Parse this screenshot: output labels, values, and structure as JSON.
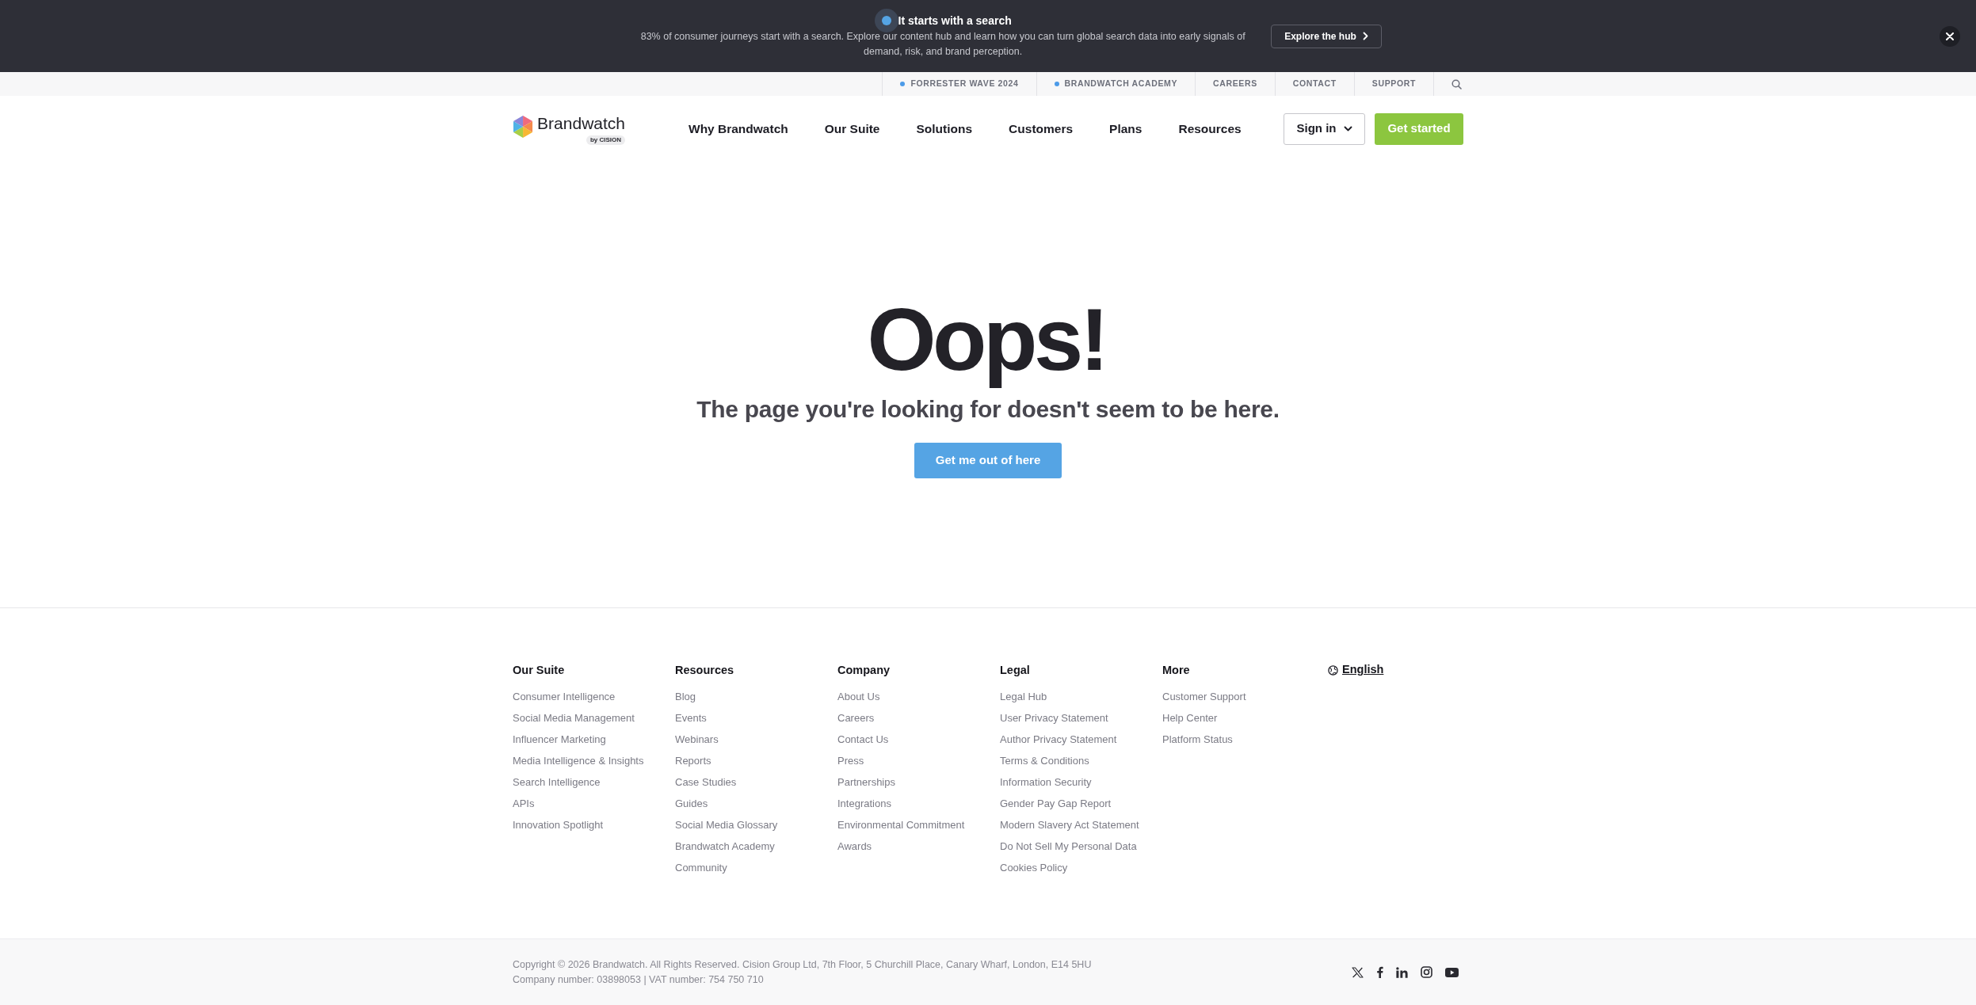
{
  "announcement": {
    "title": "It starts with a search",
    "text": "83% of consumer journeys start with a search. Explore our content hub and learn how you can turn global search data into early signals of demand, risk, and brand perception.",
    "button": "Explore the hub"
  },
  "utility_nav": {
    "links": [
      {
        "label": "FORRESTER WAVE 2024",
        "kind": "featured"
      },
      {
        "label": "BRANDWATCH ACADEMY",
        "kind": "featured"
      },
      {
        "label": "CAREERS",
        "kind": "plain"
      },
      {
        "label": "CONTACT",
        "kind": "plain"
      },
      {
        "label": "SUPPORT",
        "kind": "plain"
      }
    ]
  },
  "header": {
    "logo": {
      "name": "Brandwatch",
      "byline": "by CISION"
    },
    "nav": [
      "Why Brandwatch",
      "Our Suite",
      "Solutions",
      "Customers",
      "Plans",
      "Resources"
    ],
    "sign_in": "Sign in",
    "get_started": "Get started"
  },
  "error": {
    "heading": "Oops!",
    "message": "The page you're looking for doesn't seem to be here.",
    "button": "Get me out of here"
  },
  "footer": {
    "columns": [
      {
        "title": "Our Suite",
        "links": [
          "Consumer Intelligence",
          "Social Media Management",
          "Influencer Marketing",
          "Media Intelligence & Insights",
          "Search Intelligence",
          "APIs",
          "Innovation Spotlight"
        ]
      },
      {
        "title": "Resources",
        "links": [
          "Blog",
          "Events",
          "Webinars",
          "Reports",
          "Case Studies",
          "Guides",
          "Social Media Glossary",
          "Brandwatch Academy",
          "Community"
        ]
      },
      {
        "title": "Company",
        "links": [
          "About Us",
          "Careers",
          "Contact Us",
          "Press",
          "Partnerships",
          "Integrations",
          "Environmental Commitment",
          "Awards"
        ]
      },
      {
        "title": "Legal",
        "links": [
          "Legal Hub",
          "User Privacy Statement",
          "Author Privacy Statement",
          "Terms & Conditions",
          "Information Security",
          "Gender Pay Gap Report",
          "Modern Slavery Act Statement",
          "Do Not Sell My Personal Data",
          "Cookies Policy"
        ]
      },
      {
        "title": "More",
        "links": [
          "Customer Support",
          "Help Center",
          "Platform Status"
        ]
      }
    ],
    "language": "English"
  },
  "bottom_bar": {
    "lines": [
      "Copyright © 2026 Brandwatch. All Rights Reserved. Cision Group Ltd, 7th Floor, 5 Churchill Place, Canary Wharf, London, E14 5HU",
      "Company number: 03898053 | VAT number: 754 750 710"
    ]
  }
}
